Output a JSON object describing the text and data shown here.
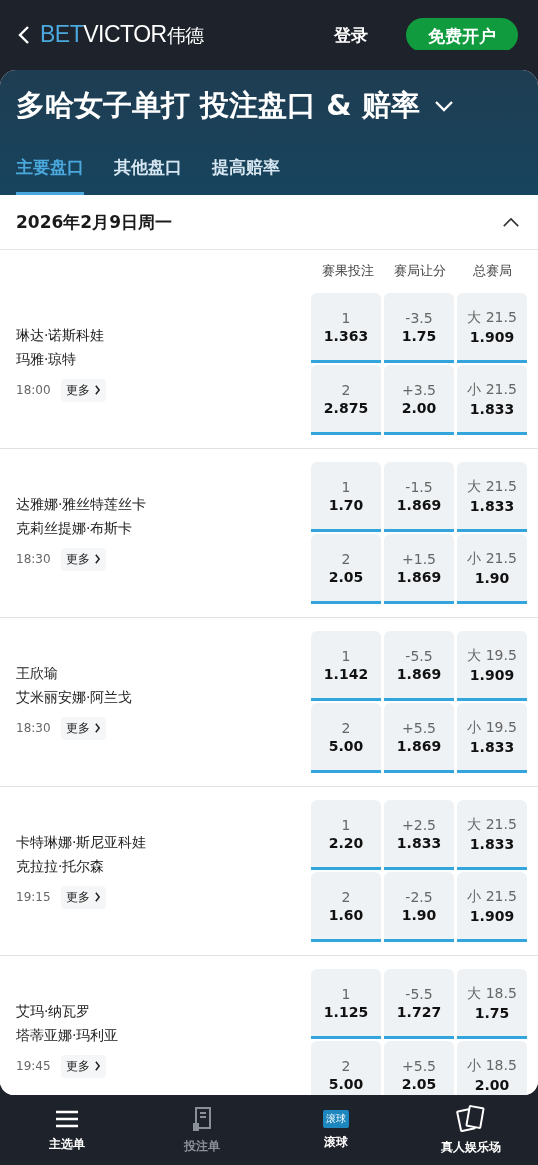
{
  "header": {
    "brand_main": "BET",
    "brand_rest": "VICTOR",
    "brand_cn": "伟德",
    "login": "登录",
    "signup": "免费开户"
  },
  "title": "多哈女子单打 投注盘口 & 赔率",
  "tabs": [
    {
      "label": "主要盘口",
      "selected": true
    },
    {
      "label": "其他盘口",
      "selected": false
    },
    {
      "label": "提高赔率",
      "selected": false
    }
  ],
  "date_section": {
    "date": "2026年2月9日周一",
    "expanded": true
  },
  "columns": [
    "赛果投注",
    "赛局让分",
    "总赛局"
  ],
  "matches": [
    {
      "player_1": "琳达·诺斯科娃",
      "player_2": "玛雅·琼特",
      "time": "18:00",
      "more": "更多",
      "odds": [
        [
          {
            "line": "1",
            "price": "1.363"
          },
          {
            "line": "-3.5",
            "price": "1.75"
          },
          {
            "line": "大 21.5",
            "price": "1.909"
          }
        ],
        [
          {
            "line": "2",
            "price": "2.875"
          },
          {
            "line": "+3.5",
            "price": "2.00"
          },
          {
            "line": "小 21.5",
            "price": "1.833"
          }
        ]
      ]
    },
    {
      "player_1": "达雅娜·雅丝特莲丝卡",
      "player_2": "克莉丝提娜·布斯卡",
      "time": "18:30",
      "more": "更多",
      "odds": [
        [
          {
            "line": "1",
            "price": "1.70"
          },
          {
            "line": "-1.5",
            "price": "1.869"
          },
          {
            "line": "大 21.5",
            "price": "1.833"
          }
        ],
        [
          {
            "line": "2",
            "price": "2.05"
          },
          {
            "line": "+1.5",
            "price": "1.869"
          },
          {
            "line": "小 21.5",
            "price": "1.90"
          }
        ]
      ]
    },
    {
      "player_1": "王欣瑜",
      "player_2": "艾米丽安娜·阿兰戈",
      "time": "18:30",
      "more": "更多",
      "odds": [
        [
          {
            "line": "1",
            "price": "1.142"
          },
          {
            "line": "-5.5",
            "price": "1.869"
          },
          {
            "line": "大 19.5",
            "price": "1.909"
          }
        ],
        [
          {
            "line": "2",
            "price": "5.00"
          },
          {
            "line": "+5.5",
            "price": "1.869"
          },
          {
            "line": "小 19.5",
            "price": "1.833"
          }
        ]
      ]
    },
    {
      "player_1": "卡特琳娜·斯尼亚科娃",
      "player_2": "克拉拉·托尔森",
      "time": "19:15",
      "more": "更多",
      "odds": [
        [
          {
            "line": "1",
            "price": "2.20"
          },
          {
            "line": "+2.5",
            "price": "1.833"
          },
          {
            "line": "大 21.5",
            "price": "1.833"
          }
        ],
        [
          {
            "line": "2",
            "price": "1.60"
          },
          {
            "line": "-2.5",
            "price": "1.90"
          },
          {
            "line": "小 21.5",
            "price": "1.909"
          }
        ]
      ]
    },
    {
      "player_1": "艾玛·纳瓦罗",
      "player_2": "塔蒂亚娜·玛利亚",
      "time": "19:45",
      "more": "更多",
      "odds": [
        [
          {
            "line": "1",
            "price": "1.125"
          },
          {
            "line": "-5.5",
            "price": "1.727"
          },
          {
            "line": "大 18.5",
            "price": "1.75"
          }
        ],
        [
          {
            "line": "2",
            "price": "5.00"
          },
          {
            "line": "+5.5",
            "price": "2.05"
          },
          {
            "line": "小 18.5",
            "price": "2.00"
          }
        ]
      ]
    }
  ],
  "bottom_nav": [
    {
      "kind": "menu",
      "label": "主选单",
      "disabled": false
    },
    {
      "kind": "betslip",
      "label": "投注单",
      "disabled": true
    },
    {
      "kind": "live",
      "label": "滚球",
      "badge": "滚球",
      "disabled": false
    },
    {
      "kind": "casino",
      "label": "真人娱乐场",
      "disabled": false
    }
  ]
}
